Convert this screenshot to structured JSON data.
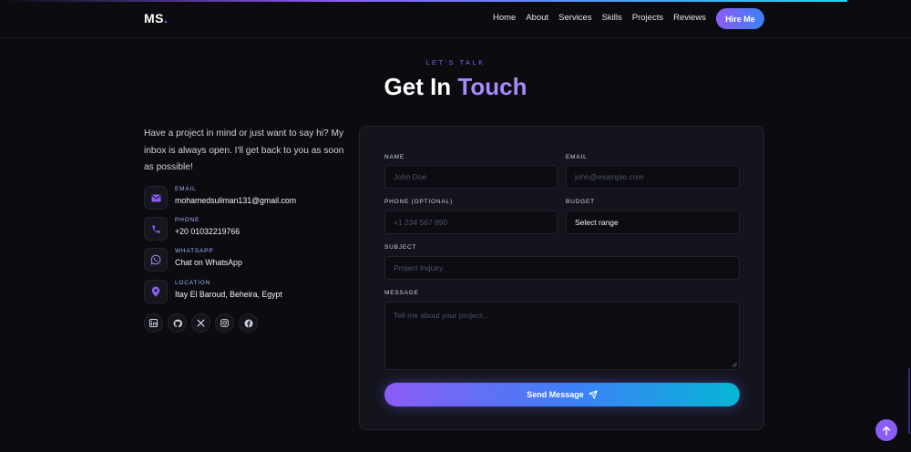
{
  "nav": {
    "logo": "MS",
    "logo_dot": ".",
    "links": [
      "Home",
      "About",
      "Services",
      "Skills",
      "Projects",
      "Reviews"
    ],
    "cta": "Hire Me"
  },
  "header": {
    "eyebrow": "LET'S TALK",
    "title_main": "Get In",
    "title_accent": "Touch"
  },
  "intro": "Have a project in mind or just want to say hi? My inbox is always open. I'll get back to you as soon as possible!",
  "contacts": [
    {
      "label": "EMAIL",
      "value": "mohamedsuliman131@gmail.com",
      "icon": "mail-icon"
    },
    {
      "label": "PHONE",
      "value": "+20 01032219766",
      "icon": "phone-icon"
    },
    {
      "label": "WHATSAPP",
      "value": "Chat on WhatsApp",
      "icon": "whatsapp-icon"
    },
    {
      "label": "LOCATION",
      "value": "Itay El Baroud, Beheira, Egypt",
      "icon": "map-pin-icon"
    }
  ],
  "socials": [
    "linkedin-icon",
    "github-icon",
    "x-icon",
    "instagram-icon",
    "facebook-icon"
  ],
  "form": {
    "name_label": "NAME",
    "name_placeholder": "John Doe",
    "email_label": "EMAIL",
    "email_placeholder": "john@example.com",
    "phone_label": "PHONE (OPTIONAL)",
    "phone_placeholder": "+1 234 567 890",
    "budget_label": "BUDGET",
    "budget_value": "Select range",
    "subject_label": "SUBJECT",
    "subject_placeholder": "Project Inquiry",
    "message_label": "MESSAGE",
    "message_placeholder": "Tell me about your project...",
    "submit": "Send Message"
  },
  "colors": {
    "background": "#0b0b10",
    "accent": "#8b5cf6",
    "accent_light": "#a78bfa",
    "gradient_end": "#06b6d4"
  }
}
